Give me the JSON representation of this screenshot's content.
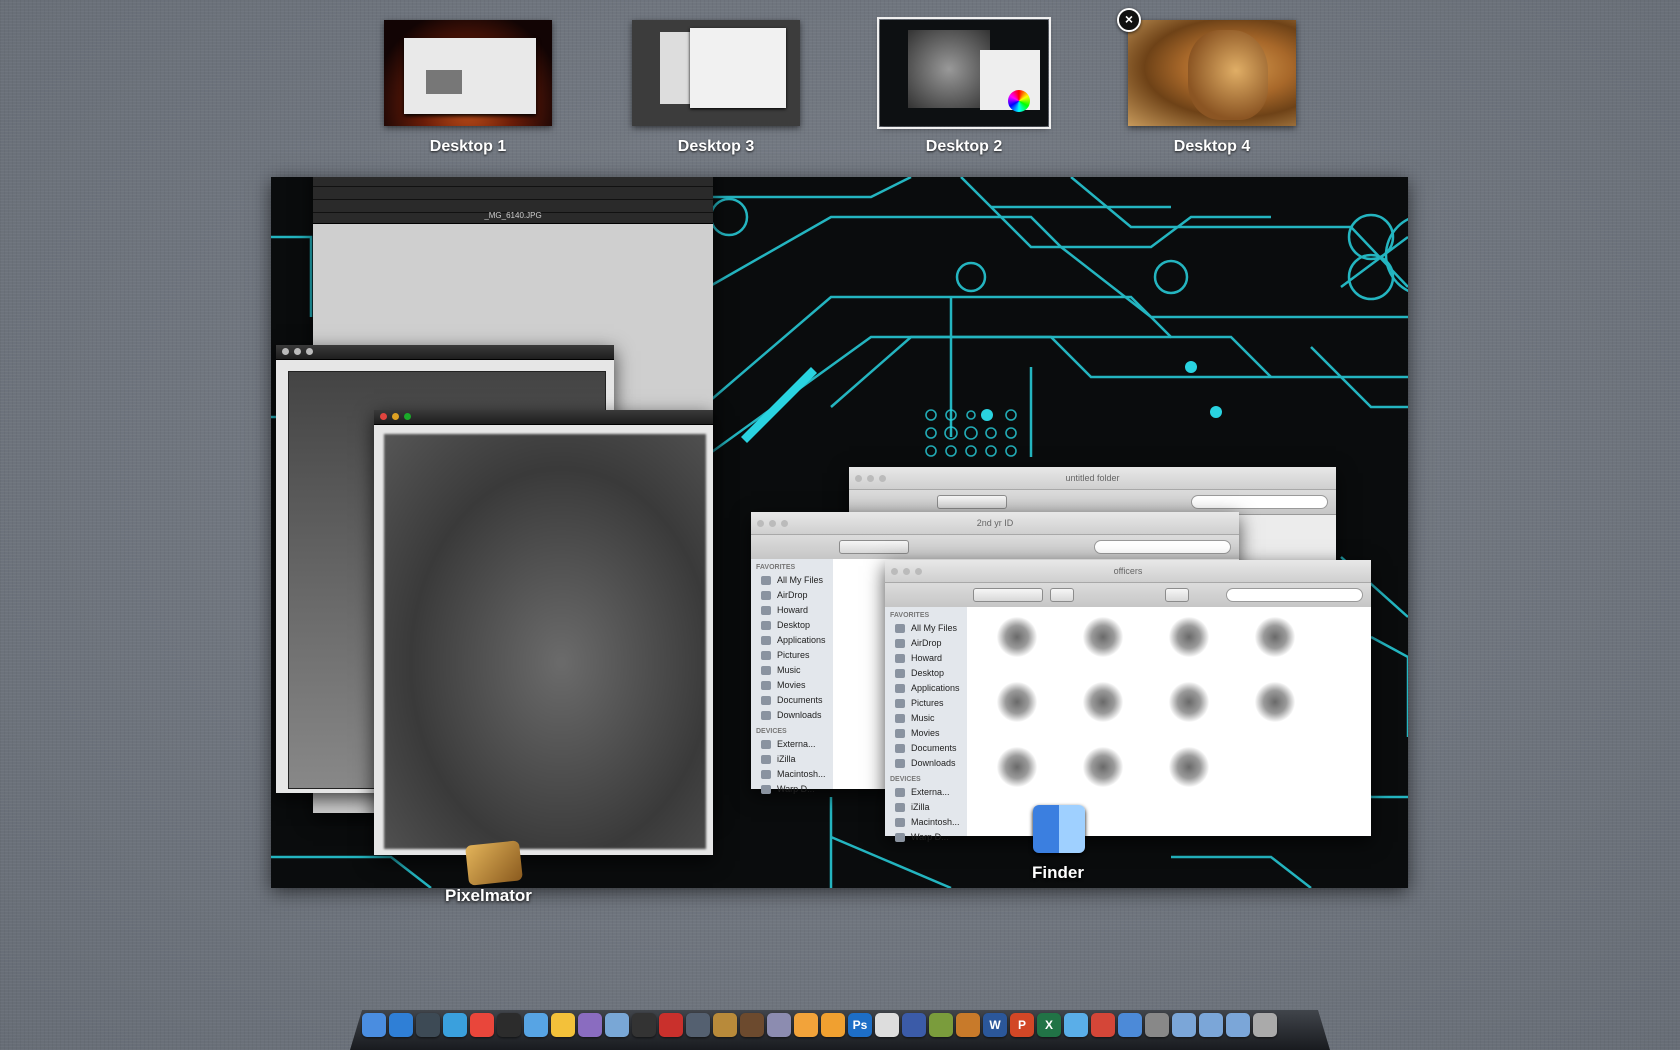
{
  "spaces": [
    {
      "label": "Desktop 1",
      "selected": false
    },
    {
      "label": "Desktop 3",
      "selected": false
    },
    {
      "label": "Desktop 2",
      "selected": true
    },
    {
      "label": "Desktop 4",
      "selected": false
    }
  ],
  "close_glyph": "×",
  "apps": {
    "pixelmator": {
      "label": "Pixelmator"
    },
    "finder": {
      "label": "Finder"
    }
  },
  "pixelmator_windows": {
    "stack_title": "_MG_6140.JPG"
  },
  "finder_windows": {
    "back_title": "untitled folder",
    "back_title_partial": "2nd yr ID",
    "front_title": "officers",
    "sidebar": {
      "favorites_header": "FAVORITES",
      "favorites": [
        "All My Files",
        "AirDrop",
        "Howard",
        "Desktop",
        "Applications",
        "Pictures",
        "Music",
        "Movies",
        "Documents",
        "Downloads"
      ],
      "devices_header": "DEVICES",
      "devices": [
        "Externa...",
        "iZilla",
        "Macintosh...",
        "Warp D..."
      ]
    }
  },
  "dock": {
    "icons": [
      "finder-icon",
      "app-store-icon",
      "time-machine-icon",
      "safari-icon",
      "chrome-icon",
      "dashboard-icon",
      "itunes-icon",
      "adium-icon",
      "preview-icon",
      "iphoto-icon",
      "dvd-player-icon",
      "acrobat-icon",
      "image-capture-icon",
      "pixelmator-icon",
      "brush-icon",
      "imovie-icon",
      "iphoto-2-icon",
      "pages-icon",
      "photoshop-icon",
      "textwrangler-icon",
      "xcode-icon",
      "coda-icon",
      "garageband-icon",
      "word-icon",
      "powerpoint-icon",
      "excel-icon",
      "messenger-icon",
      "gmail-icon",
      "keynote-icon",
      "system-preferences-icon",
      "applications-folder-icon",
      "documents-folder-icon",
      "downloads-folder-icon",
      "trash-icon"
    ],
    "glyphs": {
      "photoshop-icon": "Ps",
      "word-icon": "W",
      "powerpoint-icon": "P",
      "excel-icon": "X"
    }
  },
  "colors": {
    "circuit": "#29d3e0",
    "desktop_bg": "#0a0c0d"
  }
}
